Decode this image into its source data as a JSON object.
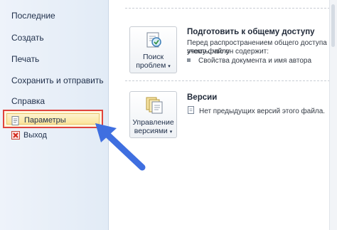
{
  "sidebar": {
    "items": [
      {
        "label": "Последние"
      },
      {
        "label": "Создать"
      },
      {
        "label": "Печать"
      },
      {
        "label": "Сохранить и отправить"
      },
      {
        "label": "Справка"
      },
      {
        "label": "Параметры",
        "icon": "document-options-icon"
      },
      {
        "label": "Выход",
        "icon": "close-icon"
      }
    ]
  },
  "prepare": {
    "button_line1": "Поиск",
    "button_line2": "проблем",
    "title": "Подготовить к общему доступу",
    "desc_line1": "Перед распространением общего доступа к этому файлу",
    "desc_line2": "учесть, что он содержит:",
    "bullet": "Свойства документа и имя автора"
  },
  "versions": {
    "button_line1": "Управление",
    "button_line2": "версиями",
    "title": "Версии",
    "text": "Нет предыдущих версий этого файла."
  },
  "colors": {
    "highlight_border": "#e0443d",
    "arrow": "#3f6fe0",
    "selected_bg": "#fbe49a"
  }
}
